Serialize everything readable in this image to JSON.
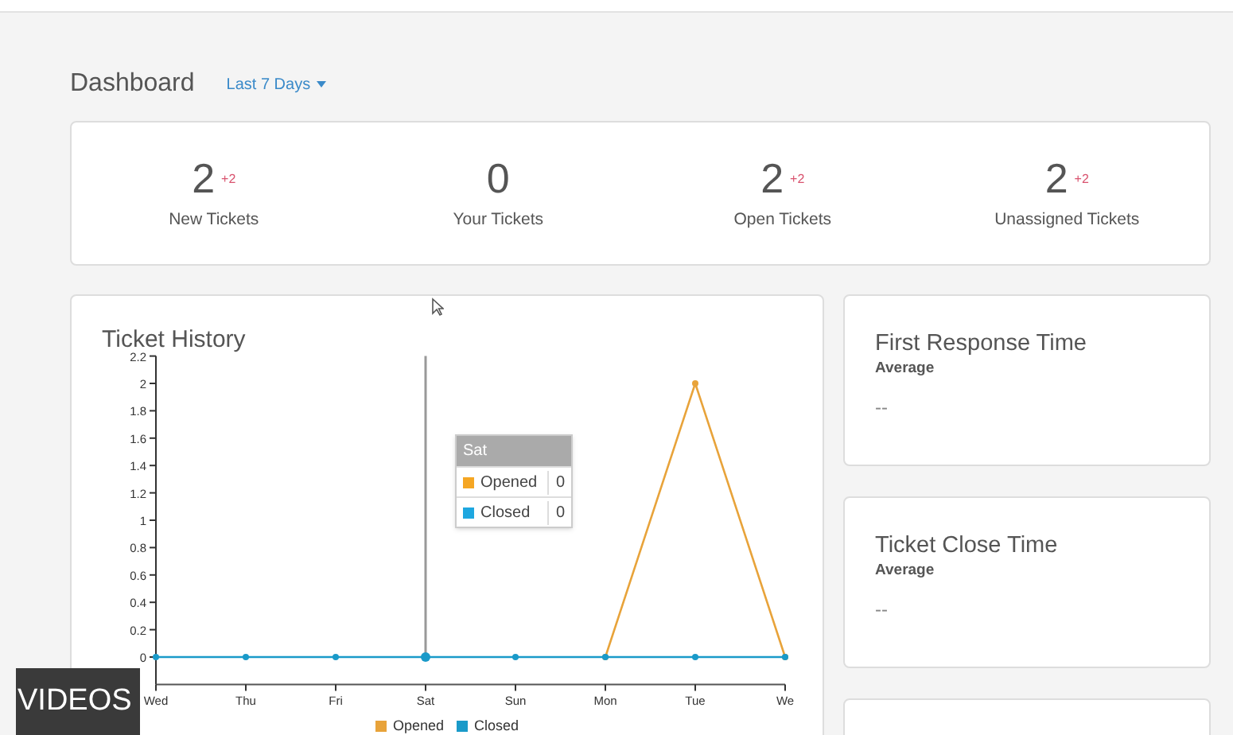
{
  "header": {
    "title": "Dashboard",
    "period": "Last 7 Days"
  },
  "stats": [
    {
      "value": "2",
      "delta": "+2",
      "label": "New Tickets"
    },
    {
      "value": "0",
      "label": "Your Tickets"
    },
    {
      "value": "2",
      "delta": "+2",
      "label": "Open Tickets"
    },
    {
      "value": "2",
      "delta": "+2",
      "label": "Unassigned Tickets"
    }
  ],
  "ticket_history": {
    "title": "Ticket History",
    "chart_data": {
      "type": "line",
      "categories": [
        "Wed",
        "Thu",
        "Fri",
        "Sat",
        "Sun",
        "Mon",
        "Tue",
        "We"
      ],
      "ylim": [
        -0.2,
        2.2
      ],
      "yticks": [
        0,
        0.2,
        0.4,
        0.6,
        0.8,
        1,
        1.2,
        1.4,
        1.6,
        1.8,
        2,
        2.2
      ],
      "legend": true,
      "series": [
        {
          "name": "Opened",
          "color": "#e8a33a",
          "marker": true,
          "values": [
            null,
            null,
            null,
            null,
            null,
            0,
            2,
            0
          ]
        },
        {
          "name": "Closed",
          "color": "#1a9ac9",
          "marker": true,
          "values": [
            0,
            0,
            0,
            0,
            0,
            0,
            0,
            0
          ]
        }
      ]
    },
    "tooltip": {
      "title": "Sat",
      "rows": [
        {
          "label": "Opened",
          "color": "#f5a623",
          "value": "0"
        },
        {
          "label": "Closed",
          "color": "#1ea7e0",
          "value": "0"
        }
      ]
    }
  },
  "metrics": [
    {
      "title": "First Response Time",
      "subtitle": "Average",
      "value": "--"
    },
    {
      "title": "Ticket Close Time",
      "subtitle": "Average",
      "value": "--"
    }
  ],
  "overlay": {
    "label": "VIDEOS"
  }
}
